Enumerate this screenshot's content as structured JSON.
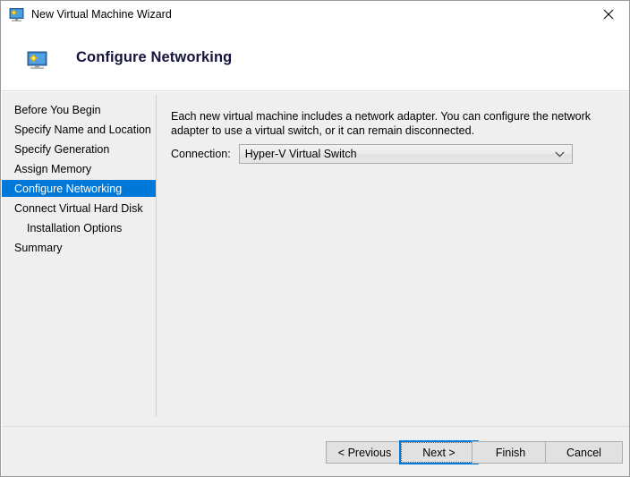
{
  "window": {
    "title": "New Virtual Machine Wizard",
    "title_icon": "virtual-machine-monitor-icon",
    "close_label": "✕"
  },
  "header": {
    "icon": "virtual-machine-monitor-icon",
    "title": "Configure Networking"
  },
  "sidebar": {
    "items": [
      {
        "label": "Before You Begin",
        "selected": false,
        "indent": false
      },
      {
        "label": "Specify Name and Location",
        "selected": false,
        "indent": false
      },
      {
        "label": "Specify Generation",
        "selected": false,
        "indent": false
      },
      {
        "label": "Assign Memory",
        "selected": false,
        "indent": false
      },
      {
        "label": "Configure Networking",
        "selected": true,
        "indent": false
      },
      {
        "label": "Connect Virtual Hard Disk",
        "selected": false,
        "indent": false
      },
      {
        "label": "Installation Options",
        "selected": false,
        "indent": true
      },
      {
        "label": "Summary",
        "selected": false,
        "indent": false
      }
    ],
    "selected_color": "#0078d7"
  },
  "main": {
    "description": "Each new virtual machine includes a network adapter. You can configure the network adapter to use a virtual switch, or it can remain disconnected.",
    "connection_label": "Connection:",
    "connection_value": "Hyper-V Virtual Switch",
    "connection_options": [
      "Hyper-V Virtual Switch"
    ],
    "dropdown_icon": "chevron-down-icon"
  },
  "footer": {
    "buttons": [
      {
        "label": "< Previous",
        "focused": false
      },
      {
        "label": "Next >",
        "focused": true
      },
      {
        "label": "Finish",
        "focused": false
      },
      {
        "label": "Cancel",
        "focused": false
      }
    ]
  }
}
